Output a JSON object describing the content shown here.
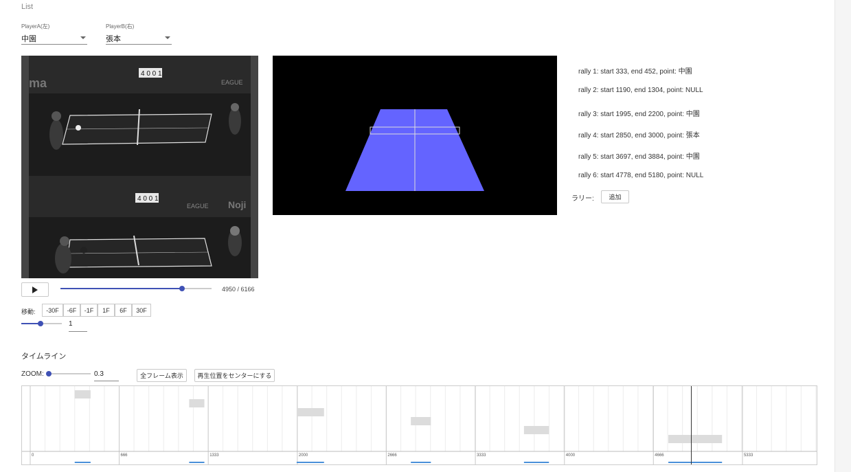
{
  "header": {
    "section_label": "List"
  },
  "players": {
    "a_label": "PlayerA(左)",
    "a_value": "中園",
    "b_label": "PlayerB(右)",
    "b_value": "張本"
  },
  "player_video": {
    "current_frame": 4950,
    "total_frames": 6166,
    "frame_counter": "4950 / 6166",
    "scoreboard_top": "4 0 0 1",
    "scoreboard_bottom": "4 0 0 1",
    "banner_left": "ma",
    "banner_right": "EAGUE",
    "banner_right_bottom": "EAGUE",
    "banner_bottom_right": "Noji"
  },
  "step_controls": {
    "label": "移動:",
    "buttons": [
      "-30F",
      "-6F",
      "-1F",
      "1F",
      "6F",
      "30F"
    ],
    "step_value": "1"
  },
  "rallies": [
    "rally 1: start 333, end 452, point: 中園",
    "rally 2: start 1190, end 1304, point: NULL",
    "rally 3: start 1995, end 2200, point: 中園",
    "rally 4: start 2850, end 3000, point: 張本",
    "rally 5: start 3697, end 3884, point: 中園",
    "rally 6: start 4778, end 5180, point: NULL"
  ],
  "rally_add": {
    "label": "ラリー:",
    "button": "追加"
  },
  "timeline": {
    "title": "タイムライン",
    "zoom_label": "ZOOM:",
    "zoom_value": "0.3",
    "show_all_button": "全フレーム表示",
    "center_button": "再生位置をセンターにする",
    "ticks": [
      "0",
      "666",
      "1333",
      "2000",
      "2666",
      "3333",
      "4000",
      "4666",
      "5333"
    ]
  },
  "colors": {
    "accent": "#3f51b5",
    "court_blue": "#6464ff",
    "timeline_marker": "#4a90d9"
  }
}
